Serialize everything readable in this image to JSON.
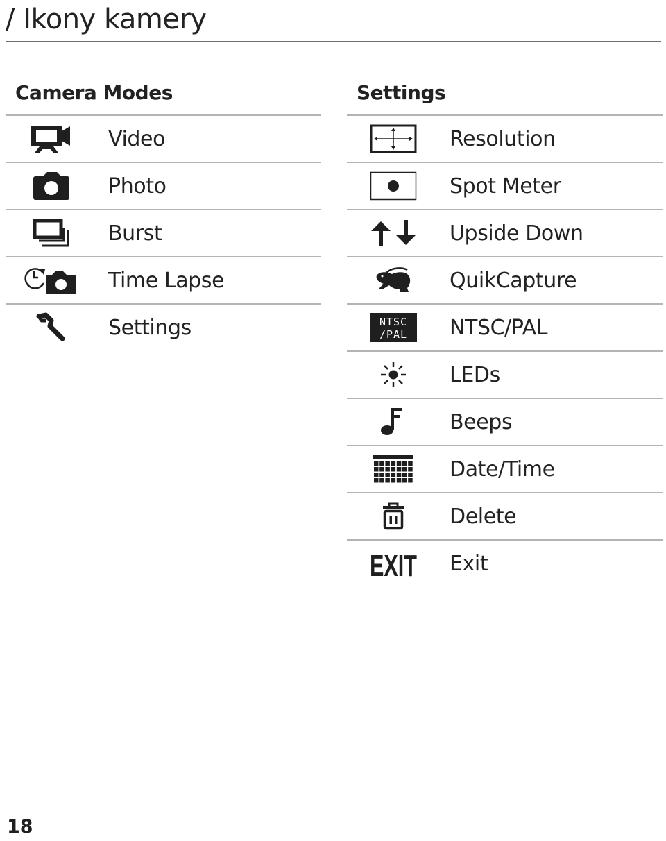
{
  "page": {
    "title": "/ Ikony kamery",
    "page_number": "18"
  },
  "camera_modes": {
    "heading": "Camera Modes",
    "items": [
      {
        "label": "Video",
        "icon": "video-camera-icon"
      },
      {
        "label": "Photo",
        "icon": "photo-camera-icon"
      },
      {
        "label": "Burst",
        "icon": "burst-icon"
      },
      {
        "label": "Time Lapse",
        "icon": "time-lapse-icon"
      },
      {
        "label": "Settings",
        "icon": "wrench-icon"
      }
    ]
  },
  "settings": {
    "heading": "Settings",
    "items": [
      {
        "label": "Resolution",
        "icon": "resolution-icon"
      },
      {
        "label": "Spot Meter",
        "icon": "spot-meter-icon"
      },
      {
        "label": "Upside Down",
        "icon": "upside-down-arrows-icon"
      },
      {
        "label": "QuikCapture",
        "icon": "rabbit-icon"
      },
      {
        "label": "NTSC/PAL",
        "icon": "ntsc-pal-icon",
        "icon_text_line1": "NTSC",
        "icon_text_line2": "/PAL"
      },
      {
        "label": "LEDs",
        "icon": "led-light-icon"
      },
      {
        "label": "Beeps",
        "icon": "music-note-icon"
      },
      {
        "label": "Date/Time",
        "icon": "calendar-icon"
      },
      {
        "label": "Delete",
        "icon": "trash-icon"
      },
      {
        "label": "Exit",
        "icon": "exit-icon",
        "icon_text": "EXIT"
      }
    ]
  }
}
